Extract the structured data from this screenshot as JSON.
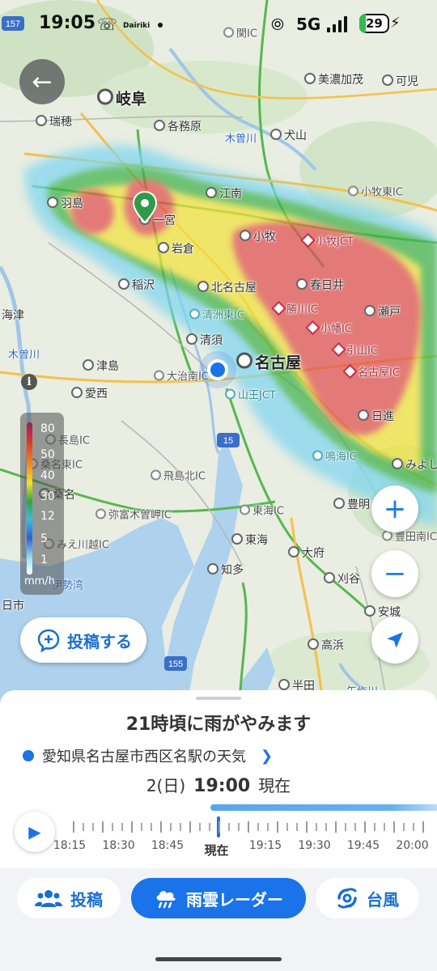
{
  "status_bar": {
    "time": "19:05",
    "carrier_logo": "Dairiki",
    "network": "5G",
    "battery": "29"
  },
  "map": {
    "places": [
      {
        "name": "関IC",
        "kind": "ic"
      },
      {
        "name": "岐阜",
        "kind": "big"
      },
      {
        "name": "美濃加茂",
        "kind": "city"
      },
      {
        "name": "可児",
        "kind": "city"
      },
      {
        "name": "瑞穂",
        "kind": "city"
      },
      {
        "name": "各務原",
        "kind": "city"
      },
      {
        "name": "木曽川",
        "kind": "river"
      },
      {
        "name": "犬山",
        "kind": "city"
      },
      {
        "name": "羽島",
        "kind": "city"
      },
      {
        "name": "一宮",
        "kind": "city"
      },
      {
        "name": "江南",
        "kind": "city"
      },
      {
        "name": "小牧東IC",
        "kind": "ic"
      },
      {
        "name": "岩倉",
        "kind": "city"
      },
      {
        "name": "小牧",
        "kind": "city"
      },
      {
        "name": "小牧JCT",
        "kind": "ic-red"
      },
      {
        "name": "稲沢",
        "kind": "city"
      },
      {
        "name": "北名古屋",
        "kind": "city"
      },
      {
        "name": "春日井",
        "kind": "city"
      },
      {
        "name": "海津",
        "kind": "nodot"
      },
      {
        "name": "清洲東IC",
        "kind": "ic-teal"
      },
      {
        "name": "勝川IC",
        "kind": "ic-red"
      },
      {
        "name": "瀬戸",
        "kind": "city"
      },
      {
        "name": "小幡IC",
        "kind": "ic-red"
      },
      {
        "name": "清須",
        "kind": "city"
      },
      {
        "name": "木曽川",
        "kind": "river"
      },
      {
        "name": "名古屋",
        "kind": "big"
      },
      {
        "name": "引山IC",
        "kind": "ic-red"
      },
      {
        "name": "津島",
        "kind": "city"
      },
      {
        "name": "大治南IC",
        "kind": "ic"
      },
      {
        "name": "名古屋IC",
        "kind": "ic-red"
      },
      {
        "name": "愛西",
        "kind": "city"
      },
      {
        "name": "山王JCT",
        "kind": "ic-teal"
      },
      {
        "name": "日進",
        "kind": "city"
      },
      {
        "name": "長島IC",
        "kind": "ic"
      },
      {
        "name": "桑名東IC",
        "kind": "ic"
      },
      {
        "name": "鳴海IC",
        "kind": "ic-teal"
      },
      {
        "name": "みよし",
        "kind": "city"
      },
      {
        "name": "桑名",
        "kind": "city"
      },
      {
        "name": "飛島北IC",
        "kind": "ic"
      },
      {
        "name": "弥富木曽岬IC",
        "kind": "ic"
      },
      {
        "name": "東海IC",
        "kind": "ic"
      },
      {
        "name": "豊明",
        "kind": "city"
      },
      {
        "name": "豊田南IC",
        "kind": "ic"
      },
      {
        "name": "東海",
        "kind": "city"
      },
      {
        "name": "大府",
        "kind": "city"
      },
      {
        "name": "みえ川越IC",
        "kind": "ic"
      },
      {
        "name": "知多",
        "kind": "city"
      },
      {
        "name": "刈谷",
        "kind": "city"
      },
      {
        "name": "伊勢湾",
        "kind": "sea"
      },
      {
        "name": "日市",
        "kind": "nodot"
      },
      {
        "name": "安城",
        "kind": "city"
      },
      {
        "name": "高浜",
        "kind": "city"
      },
      {
        "name": "半田",
        "kind": "city"
      },
      {
        "name": "矢作川",
        "kind": "river"
      }
    ],
    "road_shields": [
      "157",
      "15",
      "155",
      "1"
    ],
    "current_location": "現在地",
    "controls": {
      "back_icon": "arrow-left-icon",
      "info_icon": "info-icon",
      "zoom_in": "+",
      "zoom_out": "−",
      "locate_icon": "navigation-arrow-icon"
    },
    "legend": {
      "values": [
        "80",
        "50",
        "40",
        "30",
        "12",
        "5",
        "1"
      ],
      "unit": "mm/h"
    },
    "post_button": "投稿する",
    "accent_color": "#1a73e8"
  },
  "sheet": {
    "headline": "21時頃に雨がやみます",
    "location": "愛知県名古屋市西区名駅の天気",
    "date": "2(日)",
    "time": "19:00",
    "time_suffix": "現在",
    "timeline_labels": [
      "18:15",
      "18:30",
      "18:45",
      "現在",
      "19:15",
      "19:30",
      "19:45",
      "20:00"
    ],
    "timeline_progress": 0.45
  },
  "nav": {
    "tabs": [
      {
        "label": "投稿",
        "icon": "people-icon",
        "active": false
      },
      {
        "label": "雨雲レーダー",
        "icon": "rain-cloud-icon",
        "active": true
      },
      {
        "label": "台風",
        "icon": "typhoon-icon",
        "active": false
      }
    ]
  }
}
